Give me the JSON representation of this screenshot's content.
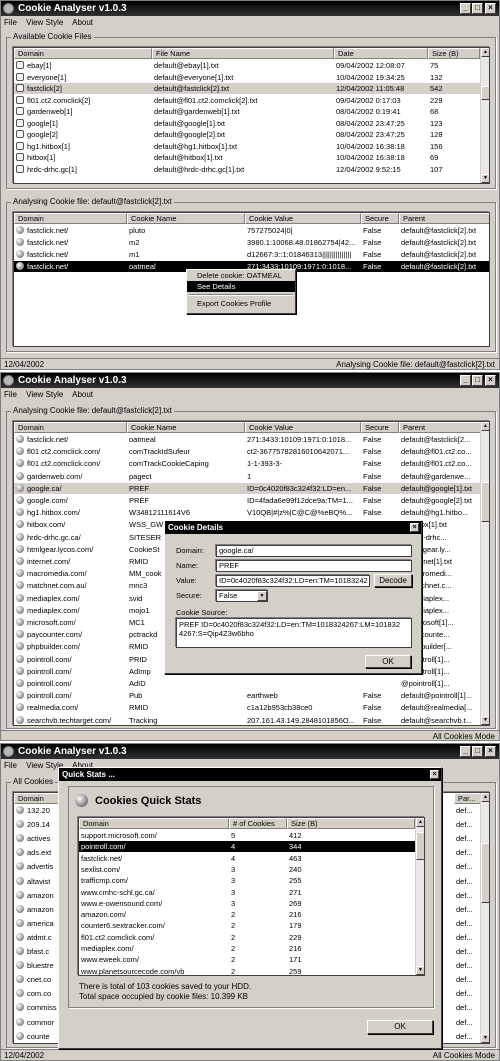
{
  "app_title": "Cookie Analyser v1.0.3",
  "colors": {
    "titlebar": "#000000",
    "face": "#d4d0c8",
    "selection": "#000000"
  },
  "menu": {
    "file": "File",
    "view_style": "View Style",
    "about": "About"
  },
  "win1": {
    "files_group": "Available Cookie Files",
    "files_headers": [
      "Domain",
      "File Name",
      "Date",
      "Size (B)"
    ],
    "files_rows": [
      [
        "ebay[1]",
        "default@ebay[1].txt",
        "09/04/2002 12:08:07",
        "75"
      ],
      [
        "everyone[1]",
        "default@everyone[1].txt",
        "10/04/2002 19:34:25",
        "132"
      ],
      [
        "fastclick[2]",
        "default@fastclick[2].txt",
        "12/04/2002 11:05:48",
        "542"
      ],
      [
        "fl01.ct2.comclick[2]",
        "default@fl01.ct2.comclick[2].txt",
        "09/04/2002 0:17:03",
        "229"
      ],
      [
        "gardenweb[1]",
        "default@gardenweb[1].txt",
        "08/04/2002 0:19:41",
        "68"
      ],
      [
        "google[1]",
        "default@google[1].txt",
        "08/04/2002 23:47:25",
        "123"
      ],
      [
        "google[2]",
        "default@google[2].txt",
        "08/04/2002 23:47:25",
        "128"
      ],
      [
        "hg1.hitbox[1]",
        "default@hg1.hitbox[1].txt",
        "10/04/2002 16:38:18",
        "156"
      ],
      [
        "hitbox[1]",
        "default@hitbox[1].txt",
        "10/04/2002 16:38:18",
        "69"
      ],
      [
        "hrdc-drhc.gc[1]",
        "default@hrdc-drhc.gc[1].txt",
        "12/04/2002 9:52:15",
        "107"
      ]
    ],
    "analysing_group": "Analysing Cookie file: default@fastclick[2].txt",
    "cookie_headers": [
      "Domain",
      "Cookie Name",
      "Cookie Value",
      "Secure",
      "Parent"
    ],
    "cookie_rows": [
      [
        "fastclick.net/",
        "pluto",
        "757275024|0|",
        "False",
        "default@fastclick[2].txt"
      ],
      [
        "fastclick.net/",
        "m2",
        "3980.1:10068.48.01862754|42...",
        "False",
        "default@fastclick[2].txt"
      ],
      [
        "fastclick.net/",
        "m1",
        "d12667:3::1:01846313|||||||||||||||",
        "False",
        "default@fastclick[2].txt"
      ],
      [
        "fastclick.net/",
        "oatmeal",
        "271:3433:10109:1971:0:1018...",
        "False",
        "default@fastclick[2].txt"
      ]
    ],
    "context_menu": [
      "Delete cookie: OATMEAL",
      "See Details",
      "Export Cookies Profile"
    ],
    "status_left": "12/04/2002",
    "status_right": "Analysing Cookie file: default@fastclick[2].txt"
  },
  "win2": {
    "group": "Analysing Cookie file: default@fastclick[2].txt",
    "headers": [
      "Domain",
      "Cookie Name",
      "Cookie Value",
      "Secure",
      "Parent"
    ],
    "rows": [
      [
        "fastclick.net/",
        "oatmeal",
        "271:3433:10109:1971:0:1018...",
        "False",
        "default@fastclick[2..."
      ],
      [
        "fl01.ct2.comclick.com/",
        "comTrackIdSufeur",
        "ct2-36775782816010642071...",
        "False",
        "default@fl01.ct2.co..."
      ],
      [
        "fl01.ct2.comclick.com/",
        "comTrackCookieCaping",
        "1-1-393-3-",
        "False",
        "default@fl01.ct2.co..."
      ],
      [
        "gardenweb.com/",
        "pagect",
        "1",
        "False",
        "default@gardenwe..."
      ],
      [
        "google.ca/",
        "PREF",
        "ID=0c4020f83c324f32:LD=en...",
        "False",
        "default@google[1].txt"
      ],
      [
        "google.com/",
        "PREF",
        "ID=4fada6e99f12dce9a:TM=1...",
        "False",
        "default@google[2].txt"
      ],
      [
        "hg1.hitbox.com/",
        "W34812111614V6",
        "V10QB|#|z%|C@C@%eBQ%...",
        "False",
        "default@hg1.hitbo..."
      ],
      [
        "hitbox.com/",
        "WSS_GW",
        "",
        "",
        "@hitbox[1].txt"
      ],
      [
        "hrdc-drhc.gc.ca/",
        "SITESER",
        "",
        "",
        "@hrdc-drhc..."
      ],
      [
        "htmlgear.lycos.com/",
        "CookieSt",
        "",
        "",
        "@htmlgear.ly..."
      ],
      [
        "internet.com/",
        "RMID",
        "",
        "",
        "@internet[1].txt"
      ],
      [
        "macromedia.com/",
        "MM_cook",
        "",
        "",
        "@macromedi..."
      ],
      [
        "matchnet.com.au/",
        "mnc3",
        "",
        "",
        "@matchnet.c..."
      ],
      [
        "mediaplex.com/",
        "svid",
        "",
        "",
        "@mediaplex..."
      ],
      [
        "mediaplex.com/",
        "mojo1",
        "",
        "",
        "@mediaplex..."
      ],
      [
        "microsoft.com/",
        "MC1",
        "",
        "",
        "@microsoft[1]..."
      ],
      [
        "paycounter.com/",
        "pctrackd",
        "",
        "",
        "@paycounte..."
      ],
      [
        "phpbuilder.com/",
        "RMID",
        "",
        "",
        "@phpbuilder[..."
      ],
      [
        "pointroll.com/",
        "PRID",
        "",
        "",
        "@pointroll[1]..."
      ],
      [
        "pointroll.com/",
        "AdImp",
        "",
        "",
        "@pointroll[1]..."
      ],
      [
        "pointroll.com/",
        "AdID",
        "",
        "",
        "@pointroll[1]..."
      ],
      [
        "pointroll.com/",
        "Pub",
        "earthweb",
        "False",
        "default@pointroll[1]..."
      ],
      [
        "realmedia.com/",
        "RMID",
        "c1a12b953cb38ce0",
        "False",
        "default@realmedia[..."
      ],
      [
        "searchvb.techtarget.com/",
        "Tracking",
        "207.161.43.149.2848101856O...",
        "False",
        "default@searchvb.t..."
      ]
    ],
    "dialog": {
      "title": "Cookie Details",
      "domain_label": "Domain:",
      "domain_value": "google.ca/",
      "name_label": "Name:",
      "name_value": "PREF",
      "value_label": "Value:",
      "value_value": "ID=0c4020f83c324f32:LD=en:TM=10183242",
      "decode_button": "Decode",
      "secure_label": "Secure:",
      "secure_value": "False",
      "source_label": "Cookie Source:",
      "source_text": "PREF ID=0c4020f83c324f32:LD=en:TM=1018324267:LM=1018324267:S=Qip4Z3w6bho",
      "ok_button": "OK"
    },
    "status_right": "All Cookies Mode"
  },
  "win3": {
    "group": "All Cookies",
    "header_domain": "Domain",
    "header_parent": "Par...",
    "back_domains": [
      "132.20",
      "209.14",
      "actives",
      "ads.ext",
      "advertis",
      "altavist",
      "amazon",
      "amazon",
      "america",
      "atdmt.c",
      "bfast.c",
      "bluestre",
      "cnet.co",
      "com.co",
      "commiss",
      "commor",
      "counte"
    ],
    "back_parent": [
      "def...",
      "def...",
      "def...",
      "def...",
      "def...",
      "def...",
      "def...",
      "def...",
      "def...",
      "def...",
      "def...",
      "def...",
      "def...",
      "def...",
      "def...",
      "def...",
      "def..."
    ],
    "dialog": {
      "title": "Quick Stats ...",
      "heading": "Cookies Quick Stats",
      "headers": [
        "Domain",
        "# of Cookies",
        "Size (B)"
      ],
      "rows": [
        [
          "support.microsoft.com/",
          "5",
          "412"
        ],
        [
          "pointroll.com/",
          "4",
          "344"
        ],
        [
          "fastclick.net/",
          "4",
          "463"
        ],
        [
          "sexlist.com/",
          "3",
          "240"
        ],
        [
          "trafficmp.com/",
          "3",
          "255"
        ],
        [
          "www.cmhc-schl.gc.ca/",
          "3",
          "271"
        ],
        [
          "www.e-owensound.com/",
          "3",
          "269"
        ],
        [
          "amazon.com/",
          "2",
          "216"
        ],
        [
          "counter6.sextracker.com/",
          "2",
          "179"
        ],
        [
          "fl01.ct2.comclick.com/",
          "2",
          "229"
        ],
        [
          "mediaplex.com/",
          "2",
          "216"
        ],
        [
          "www.eweek.com/",
          "2",
          "171"
        ],
        [
          "www.planetsourcecode.com/vb",
          "2",
          "259"
        ]
      ],
      "total_cookies": "There is total of 103 cookies saved to your HDD.",
      "total_space": "Total space occupied by cookie files: 10.399 KB",
      "ok_button": "OK"
    },
    "status_left": "12/04/2002",
    "status_right": "All Cookies Mode"
  }
}
